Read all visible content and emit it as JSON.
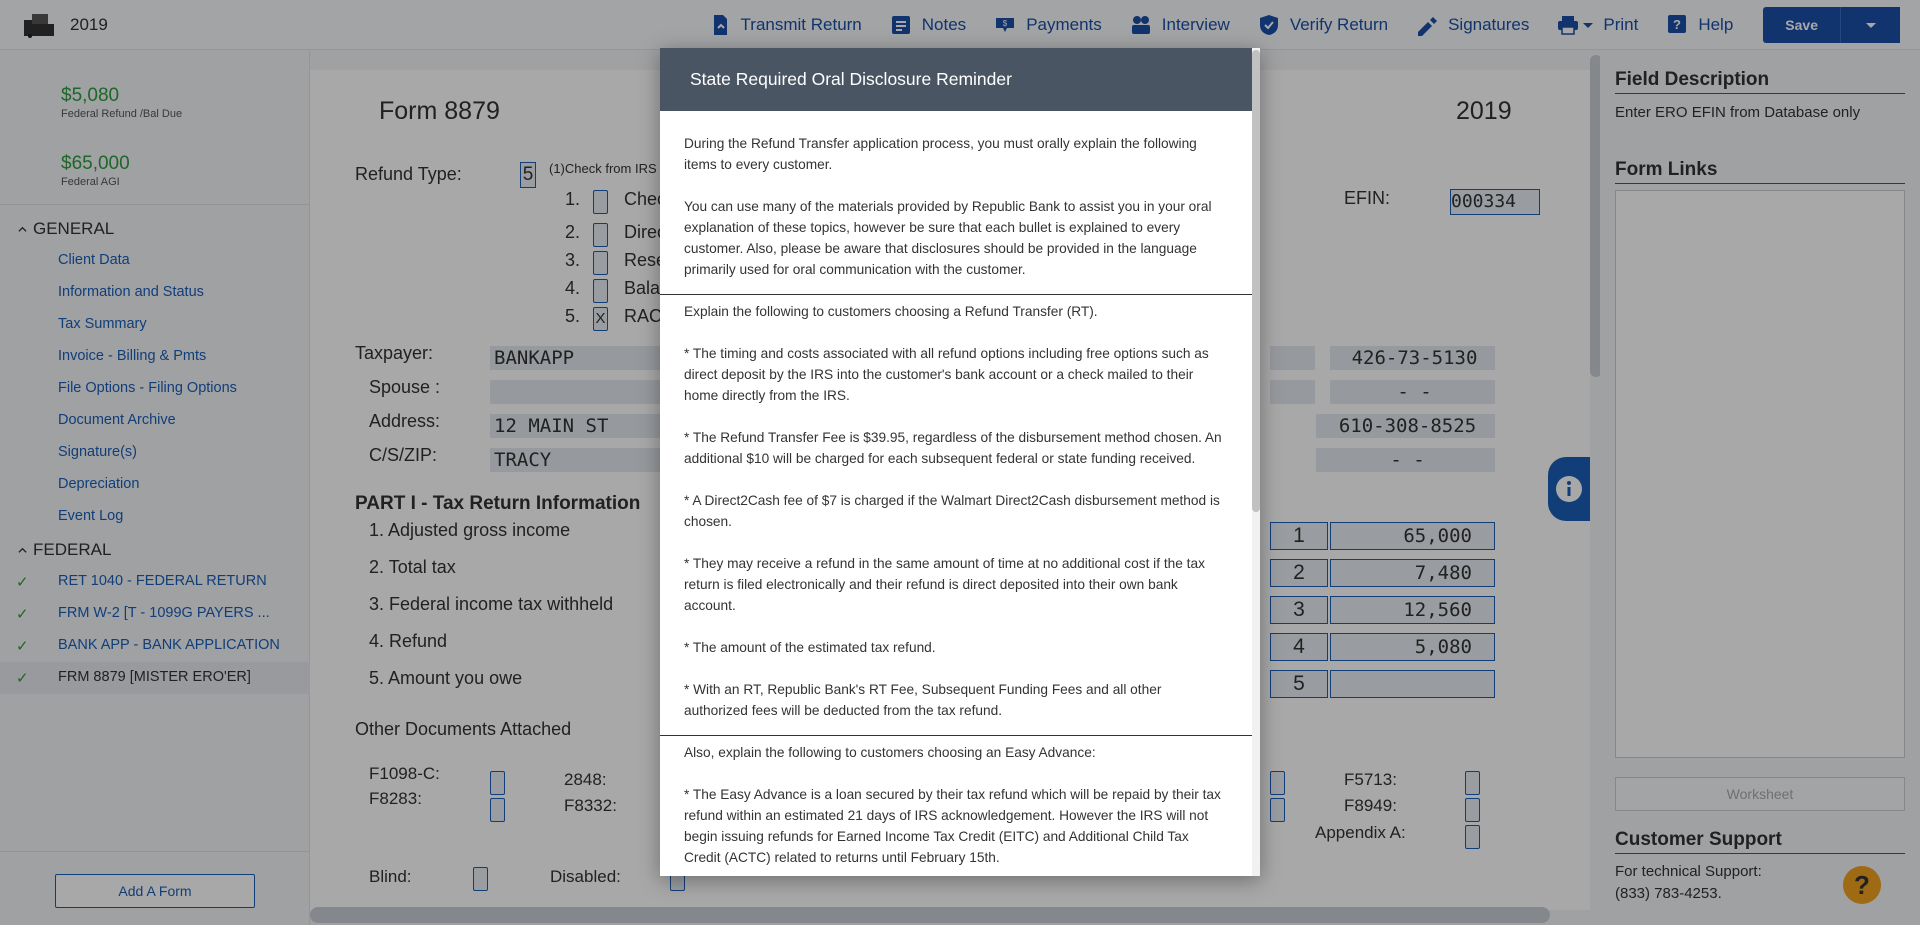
{
  "topbar": {
    "year": "2019",
    "nav": [
      {
        "icon": "transmit-icon",
        "label": "Transmit Return"
      },
      {
        "icon": "notes-icon",
        "label": "Notes"
      },
      {
        "icon": "payments-icon",
        "label": "Payments"
      },
      {
        "icon": "interview-icon",
        "label": "Interview"
      },
      {
        "icon": "verify-icon",
        "label": "Verify Return"
      },
      {
        "icon": "signatures-icon",
        "label": "Signatures"
      },
      {
        "icon": "print-icon",
        "label": "Print"
      },
      {
        "icon": "help-icon",
        "label": "Help"
      }
    ],
    "save_label": "Save",
    "accent": "#1b4fa8"
  },
  "sidebar": {
    "refund_amount": "$5,080",
    "refund_label": "Federal Refund /Bal Due",
    "agi_amount": "$65,000",
    "agi_label": "Federal AGI",
    "general_title": "GENERAL",
    "general_items": [
      "Client Data",
      "Information and Status",
      "Tax Summary",
      "Invoice - Billing & Pmts",
      "File Options - Filing Options",
      "Document Archive",
      "Signature(s)",
      "Depreciation",
      "Event Log"
    ],
    "federal_title": "FEDERAL",
    "federal_items": [
      "RET 1040 - FEDERAL RETURN",
      "FRM W-2 [T - 1099G PAYERS ...",
      "BANK APP - BANK APPLICATION",
      "FRM 8879 [MISTER ERO'ER]"
    ],
    "add_form_label": "Add A Form"
  },
  "form": {
    "title": "Form 8879",
    "year": "2019",
    "refund_type_label": "Refund Type:",
    "refund_type_value": "5",
    "refund_type_note": "(1)Check from IRS",
    "options": [
      {
        "num": "1.",
        "text": "Chec",
        "checked": ""
      },
      {
        "num": "2.",
        "text": "Direc",
        "checked": ""
      },
      {
        "num": "3.",
        "text": "Rese",
        "checked": ""
      },
      {
        "num": "4.",
        "text": "Bala",
        "checked": ""
      },
      {
        "num": "5.",
        "text": "RAC",
        "checked": "X"
      }
    ],
    "efin_label": "EFIN:",
    "efin_value": "000334",
    "taxpayer_label": "Taxpayer:",
    "taxpayer_value": "BANKAPP",
    "taxpayer_ssn": "426-73-5130",
    "spouse_label": "Spouse :",
    "spouse_ssn": "-  -",
    "address_label": "Address:",
    "address_value": "12 MAIN ST",
    "phone": "610-308-8525",
    "csz_label": "C/S/ZIP:",
    "csz_value": "TRACY",
    "phone2": "-  -",
    "part_title": "PART I - Tax Return Information",
    "lines": [
      {
        "label": "1. Adjusted gross income",
        "num": "1",
        "value": "65,000"
      },
      {
        "label": "2. Total tax",
        "num": "2",
        "value": "7,480"
      },
      {
        "label": "3. Federal income tax withheld",
        "num": "3",
        "value": "12,560"
      },
      {
        "label": "4. Refund",
        "num": "4",
        "value": "5,080"
      },
      {
        "label": "5. Amount you owe",
        "num": "5",
        "value": ""
      }
    ],
    "other_docs_label": "Other Documents Attached",
    "docs": [
      "F1098-C:",
      "2848:",
      "F8283:",
      "F8332:",
      "F5713:",
      "F8949:",
      "Appendix A:"
    ],
    "blind_label": "Blind:",
    "disabled_label": "Disabled:"
  },
  "right_panel": {
    "field_desc_title": "Field Description",
    "field_desc_text": "Enter ERO EFIN from Database only",
    "form_links_title": "Form Links",
    "worksheet_label": "Worksheet",
    "support_title": "Customer Support",
    "support_text": "For technical Support:",
    "support_phone": "(833) 783-4253."
  },
  "modal": {
    "title": "State Required Oral Disclosure Reminder",
    "intro1": "During the Refund Transfer application process, you must orally explain the following items to every customer.",
    "intro2": "You can use many of the materials provided by Republic Bank to assist you in your oral explanation of these topics, however be sure that each bullet is explained to every customer. Also, please be aware that disclosures should be provided in the language primarily used for oral communication with the customer.",
    "rt_heading": "Explain the following to customers choosing a Refund Transfer (RT).",
    "rt_bullets": [
      "*  The timing and costs associated with all refund options including free options such as direct deposit by the IRS into the customer's bank account or a check mailed to their home directly from the IRS.",
      "*  The Refund Transfer Fee is $39.95, regardless of the disbursement method chosen. An additional $10 will be charged for each subsequent federal or state funding received.",
      "*  A Direct2Cash fee of $7 is charged if the Walmart Direct2Cash disbursement method is chosen.",
      "*  They may receive a refund in the same amount of time at no additional cost if the tax return is filed electronically and their refund is direct deposited into their own bank account.",
      "*  The amount of the estimated tax refund.",
      "*  With an RT, Republic Bank's RT Fee, Subsequent Funding Fees and all other authorized fees will be deducted from the tax refund."
    ],
    "ea_heading": "Also, explain the following to customers choosing an Easy Advance:",
    "ea_bullets": [
      "*  The Easy Advance is a loan secured by their tax refund which will be repaid by their tax refund within an estimated 21 days of IRS acknowledgement.  However the IRS will not begin issuing refunds for Earned Income Tax Credit (EITC) and Additional Child Tax Credit (ACTC) related to returns until February 15th."
    ]
  }
}
